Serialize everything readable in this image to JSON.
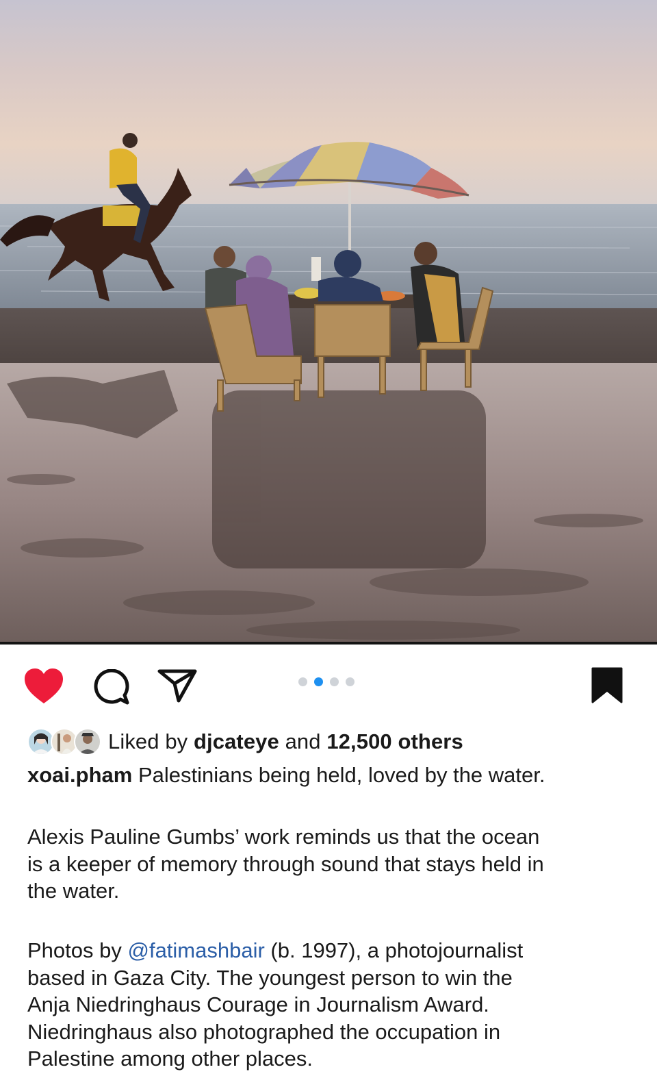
{
  "post": {
    "image": {
      "description_name": "post-photo"
    },
    "carousel": {
      "count": 4,
      "active_index": 1
    },
    "actions": {
      "like_icon": "heart-filled-icon",
      "comment_icon": "comment-bubble-icon",
      "share_icon": "paper-plane-icon",
      "save_icon": "bookmark-filled-icon",
      "liked": true,
      "saved": true,
      "like_color": "#ed1c3a"
    },
    "likes": {
      "prefix": "Liked by ",
      "user": "djcateye",
      "middle": " and ",
      "count": "12,500 others"
    },
    "caption": {
      "username": "xoai.pham",
      "first_line": " Palestinians being held, loved by the water.",
      "paragraph1": [
        "Alexis Pauline Gumbs’ work reminds us that the ocean",
        "is a keeper of memory through sound that stays held in",
        "the water."
      ],
      "paragraph2": {
        "lead": "Photos by ",
        "mention": "@fatimashbair",
        "rest_first": " (b. 1997), a photojournalist",
        "lines": [
          "based in Gaza City. The youngest person to win the",
          "Anja Niedringhaus Courage in Journalism Award.",
          "Niedringhaus also photographed the occupation in",
          "Palestine among other places."
        ]
      }
    },
    "colors": {
      "mention": "#2b5ea7",
      "active_dot": "#1e90f0",
      "inactive_dot": "#cfd3d8"
    }
  }
}
